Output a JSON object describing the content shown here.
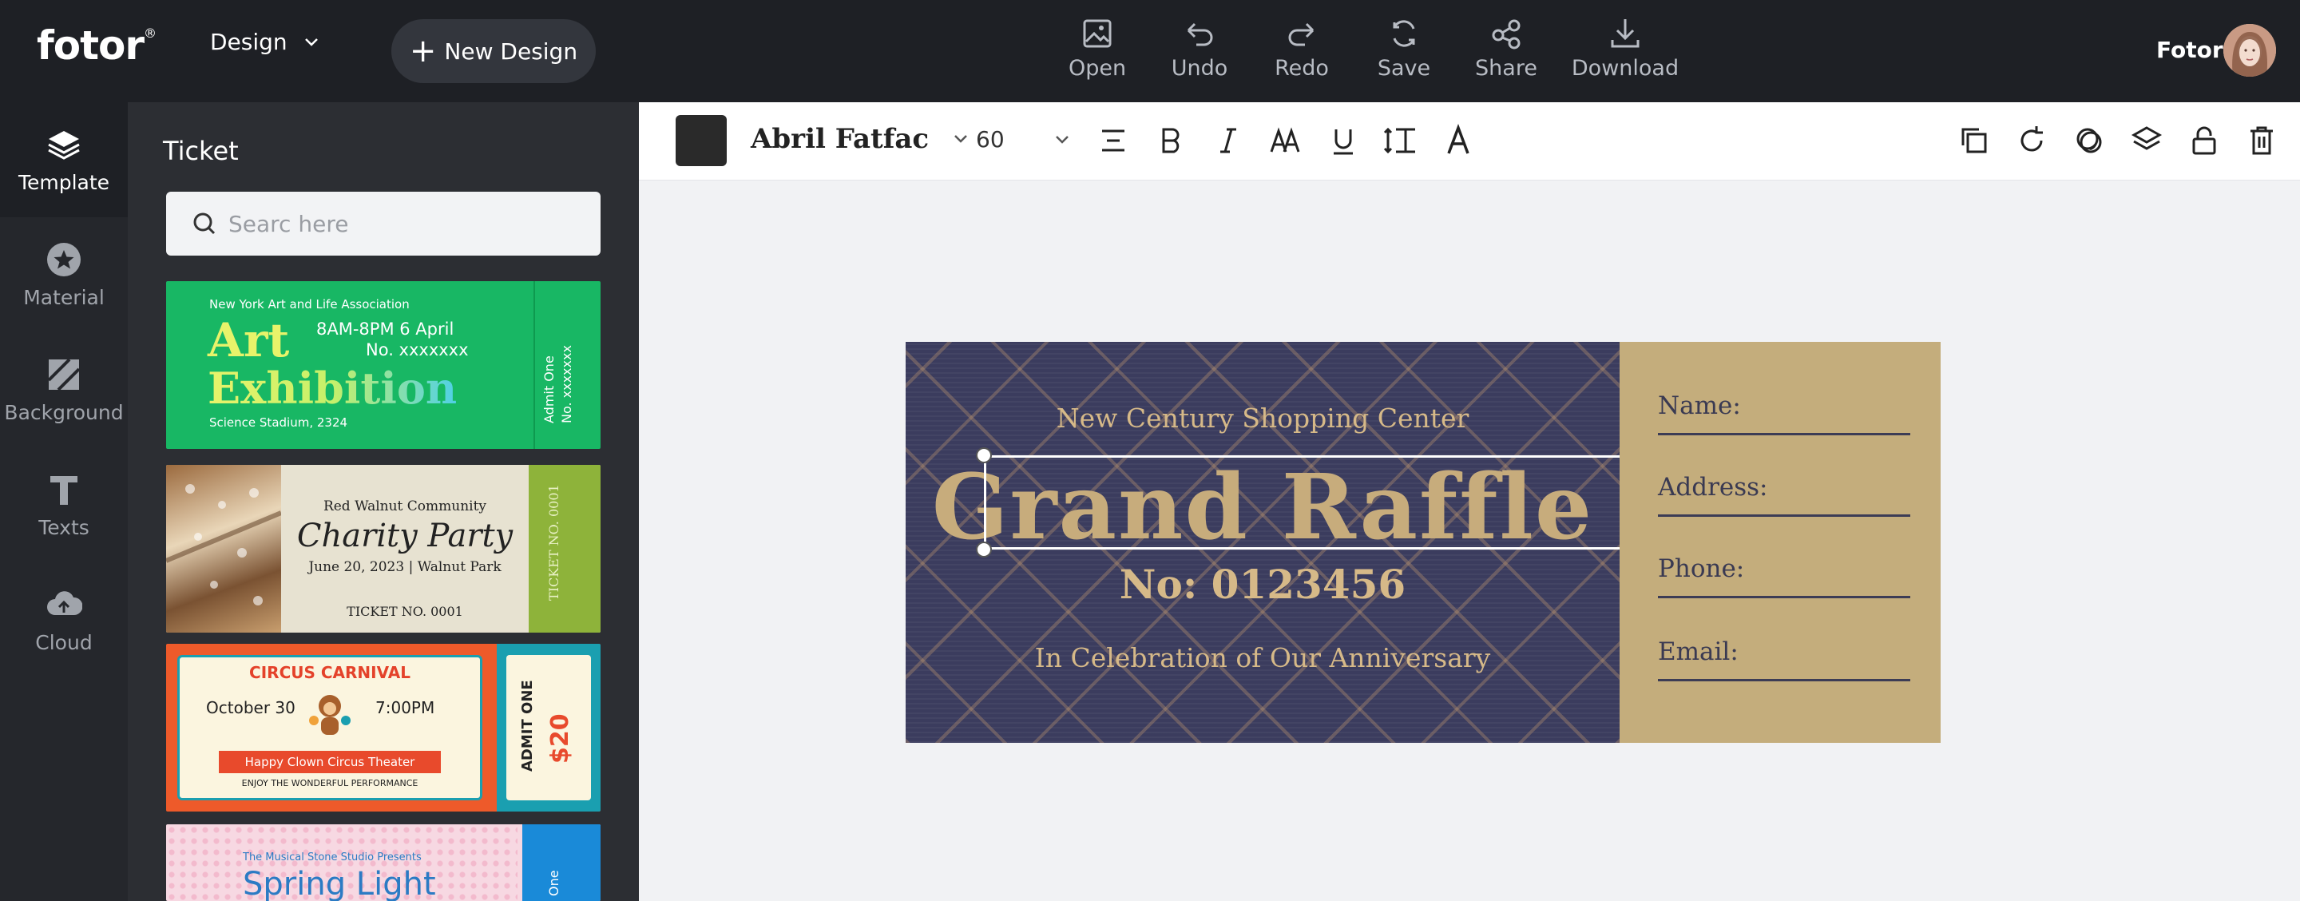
{
  "brand": {
    "name": "fotor",
    "mark": "®"
  },
  "header": {
    "design_menu": "Design",
    "new_design": "New Design",
    "tools": [
      {
        "label": "Open",
        "icon": "open-image-icon"
      },
      {
        "label": "Undo",
        "icon": "undo-icon"
      },
      {
        "label": "Redo",
        "icon": "redo-icon"
      },
      {
        "label": "Save",
        "icon": "save-icon"
      },
      {
        "label": "Share",
        "icon": "share-icon"
      },
      {
        "label": "Download",
        "icon": "download-icon"
      }
    ],
    "user_name": "Fotor"
  },
  "leftnav": [
    {
      "label": "Template",
      "icon": "layers-icon",
      "active": true
    },
    {
      "label": "Material",
      "icon": "star-icon"
    },
    {
      "label": "Background",
      "icon": "background-icon"
    },
    {
      "label": "Texts",
      "icon": "text-icon"
    },
    {
      "label": "Cloud",
      "icon": "cloud-upload-icon"
    }
  ],
  "panel": {
    "title": "Ticket",
    "search_placeholder": "Searc here",
    "templates": [
      {
        "org": "New York Art and Life Association",
        "title1": "Art",
        "title2": "Exhibition",
        "time": "8AM-8PM 6 April",
        "no": "No. xxxxxxx",
        "venue": "Science Stadium, 2324",
        "stub1": "Admit One",
        "stub2": "No. xxxxxxx"
      },
      {
        "org": "Red Walnut Community",
        "title": "Charity Party",
        "date": "June 20, 2023 | Walnut Park",
        "ticket_no": "TICKET NO. 0001",
        "stub": "TICKET NO. 0001"
      },
      {
        "title": "CIRCUS CARNIVAL",
        "date": "October 30",
        "time": "7:00PM",
        "venue": "Happy Clown Circus Theater",
        "tagline": "ENJOY THE WONDERFUL PERFORMANCE",
        "stub1": "ADMIT ONE",
        "stub2": "$20"
      },
      {
        "org": "The Musical Stone Studio Presents",
        "title": "Spring Light",
        "stub": "One"
      }
    ]
  },
  "text_toolbar": {
    "font": "Abril Fatfac",
    "size": "60",
    "text_color": "#2a2a2a"
  },
  "ticket": {
    "subtitle_top": "New Century Shopping Center",
    "title": "Grand Raffle",
    "number": "No: 0123456",
    "subtitle_bottom": "In Celebration of Our Anniversary",
    "fields": [
      "Name:",
      "Address:",
      "Phone:",
      "Email:"
    ],
    "colors": {
      "main": "#3b3c5e",
      "stub": "#c4ad7c",
      "text": "#d6b988"
    }
  }
}
